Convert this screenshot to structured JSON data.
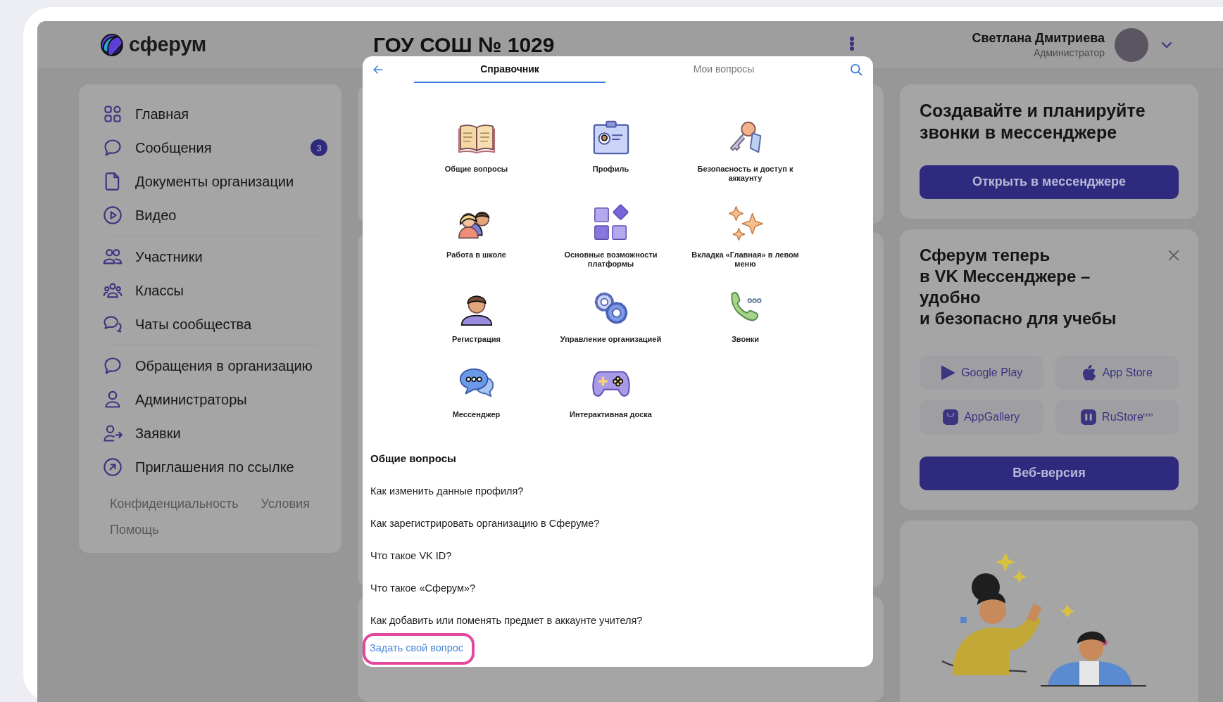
{
  "header": {
    "logo": "сферум",
    "title": "ГОУ СОШ № 1029",
    "user_name": "Светлана Дмитриева",
    "user_role": "Администратор"
  },
  "sidebar": {
    "groups": [
      [
        {
          "label": "Главная"
        },
        {
          "label": "Сообщения",
          "badge": "3"
        },
        {
          "label": "Документы организации"
        },
        {
          "label": "Видео"
        }
      ],
      [
        {
          "label": "Участники"
        },
        {
          "label": "Классы"
        },
        {
          "label": "Чаты сообщества"
        }
      ],
      [
        {
          "label": "Обращения в организацию"
        },
        {
          "label": "Администраторы"
        },
        {
          "label": "Заявки"
        },
        {
          "label": "Приглашения по ссылке"
        }
      ]
    ],
    "footer_links": [
      "Конфиденциальность",
      "Условия",
      "Помощь"
    ]
  },
  "modal": {
    "tabs": [
      {
        "label": "Справочник",
        "selected": true
      },
      {
        "label": "Мои вопросы",
        "selected": false
      }
    ],
    "categories": [
      "Общие вопросы",
      "Профиль",
      "Безопасность и доступ к аккаунту",
      "Работа в школе",
      "Основные возможности платформы",
      "Вкладка «Главная» в левом меню",
      "Регистрация",
      "Управление организацией",
      "Звонки",
      "Мессенджер",
      "Интерактивная доска"
    ],
    "section_title": "Общие вопросы",
    "questions": [
      "Как изменить данные профиля?",
      "Как зарегистрировать организацию в Сферуме?",
      "Что такое VK ID?",
      "Что такое «Сферум»?",
      "Как добавить или поменять предмет в аккаунте учителя?"
    ],
    "ask_link": {
      "label": "Задать свой вопрос",
      "highlighted": true
    }
  },
  "messenger_card": {
    "title": "Создавайте и планируйте\nзвонки в мессенджере",
    "button": "Открыть в мессенджере"
  },
  "apps_card": {
    "title": "Сферум теперь\nв VK Мессенджере – удобно\nи безопасно для учебы",
    "stores": [
      "Google Play",
      "App Store",
      "AppGallery",
      "RuStore$^{beta}$"
    ],
    "button": "Веб-версия"
  }
}
